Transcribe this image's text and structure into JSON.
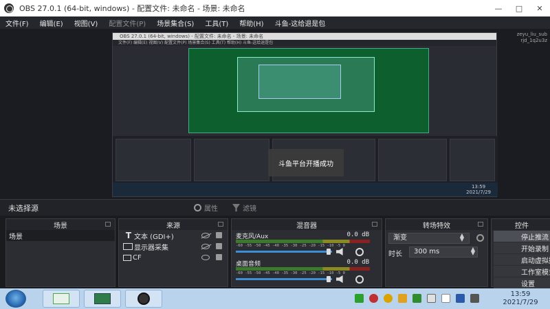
{
  "window": {
    "title": "OBS 27.0.1 (64-bit, windows) - 配置文件: 未命名 - 场景: 未命名",
    "controls": [
      "minimize",
      "maximize",
      "close"
    ]
  },
  "menu": [
    "文件(F)",
    "编辑(E)",
    "视图(V)",
    "配置文件(P)",
    "场景集合(S)",
    "工具(T)",
    "帮助(H)",
    "斗鱼-这给退是包"
  ],
  "preview": {
    "nested_title": "OBS 27.0.1 (64-bit, windows) - 配置文件: 未命名 - 场景: 未命名",
    "nested_menu": "文件(F)  编辑(E)  视图(V)  配置文件(P)  场景集合(S)  工具(T)  帮助(H)  斗鱼-这给退是包",
    "toast": "斗鱼平台开播成功",
    "nested_clock_time": "13:59",
    "nested_clock_date": "2021/7/29",
    "corner_text": "zeyu_liu_sub\nrjd_1q2u3z"
  },
  "source_bar": {
    "no_source": "未选择源",
    "properties": "属性",
    "filters": "滤镜"
  },
  "scenes": {
    "header": "场景",
    "items": [
      "场景"
    ]
  },
  "sources": {
    "header": "来源",
    "items": [
      {
        "label": "文本 (GDI+)",
        "icon": "text-icon",
        "visible": false
      },
      {
        "label": "显示器采集",
        "icon": "monitor-icon",
        "visible": false
      },
      {
        "label": "CF",
        "icon": "window-icon",
        "visible": true
      }
    ]
  },
  "mixer": {
    "header": "混音器",
    "channels": [
      {
        "name": "麦克风/Aux",
        "db": "0.0 dB"
      },
      {
        "name": "桌面音频",
        "db": "0.0 dB"
      }
    ],
    "scale": "-60 -55 -50 -45 -40 -35 -30 -25 -20 -15 -10 -5 0"
  },
  "transitions": {
    "header": "转场特效",
    "selected": "渐变",
    "duration_label": "时长",
    "duration_value": "300 ms"
  },
  "controls": {
    "header": "控件",
    "buttons": [
      "停止推流",
      "开始录制",
      "启动虚拟摄像机",
      "工作室模式",
      "设置"
    ]
  },
  "taskbar": {
    "time": "13:59",
    "date": "2021/7/29",
    "tray_colors": [
      "#2ca02c",
      "#c03030",
      "#d9a300",
      "#e0a020",
      "#2e8b2e",
      "#e0e0e0",
      "#ffffff",
      "#2b5aa8",
      "#555555"
    ]
  }
}
